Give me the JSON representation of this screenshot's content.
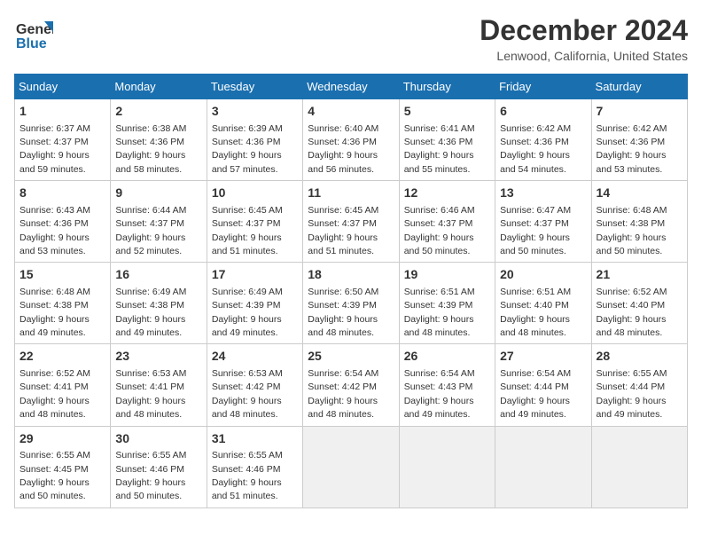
{
  "header": {
    "logo_line1": "General",
    "logo_line2": "Blue",
    "month": "December 2024",
    "location": "Lenwood, California, United States"
  },
  "weekdays": [
    "Sunday",
    "Monday",
    "Tuesday",
    "Wednesday",
    "Thursday",
    "Friday",
    "Saturday"
  ],
  "weeks": [
    [
      {
        "day": 1,
        "rise": "6:37 AM",
        "set": "4:37 PM",
        "hours": "9 hours and 59 minutes."
      },
      {
        "day": 2,
        "rise": "6:38 AM",
        "set": "4:36 PM",
        "hours": "9 hours and 58 minutes."
      },
      {
        "day": 3,
        "rise": "6:39 AM",
        "set": "4:36 PM",
        "hours": "9 hours and 57 minutes."
      },
      {
        "day": 4,
        "rise": "6:40 AM",
        "set": "4:36 PM",
        "hours": "9 hours and 56 minutes."
      },
      {
        "day": 5,
        "rise": "6:41 AM",
        "set": "4:36 PM",
        "hours": "9 hours and 55 minutes."
      },
      {
        "day": 6,
        "rise": "6:42 AM",
        "set": "4:36 PM",
        "hours": "9 hours and 54 minutes."
      },
      {
        "day": 7,
        "rise": "6:42 AM",
        "set": "4:36 PM",
        "hours": "9 hours and 53 minutes."
      }
    ],
    [
      {
        "day": 8,
        "rise": "6:43 AM",
        "set": "4:36 PM",
        "hours": "9 hours and 53 minutes."
      },
      {
        "day": 9,
        "rise": "6:44 AM",
        "set": "4:37 PM",
        "hours": "9 hours and 52 minutes."
      },
      {
        "day": 10,
        "rise": "6:45 AM",
        "set": "4:37 PM",
        "hours": "9 hours and 51 minutes."
      },
      {
        "day": 11,
        "rise": "6:45 AM",
        "set": "4:37 PM",
        "hours": "9 hours and 51 minutes."
      },
      {
        "day": 12,
        "rise": "6:46 AM",
        "set": "4:37 PM",
        "hours": "9 hours and 50 minutes."
      },
      {
        "day": 13,
        "rise": "6:47 AM",
        "set": "4:37 PM",
        "hours": "9 hours and 50 minutes."
      },
      {
        "day": 14,
        "rise": "6:48 AM",
        "set": "4:38 PM",
        "hours": "9 hours and 50 minutes."
      }
    ],
    [
      {
        "day": 15,
        "rise": "6:48 AM",
        "set": "4:38 PM",
        "hours": "9 hours and 49 minutes."
      },
      {
        "day": 16,
        "rise": "6:49 AM",
        "set": "4:38 PM",
        "hours": "9 hours and 49 minutes."
      },
      {
        "day": 17,
        "rise": "6:49 AM",
        "set": "4:39 PM",
        "hours": "9 hours and 49 minutes."
      },
      {
        "day": 18,
        "rise": "6:50 AM",
        "set": "4:39 PM",
        "hours": "9 hours and 48 minutes."
      },
      {
        "day": 19,
        "rise": "6:51 AM",
        "set": "4:39 PM",
        "hours": "9 hours and 48 minutes."
      },
      {
        "day": 20,
        "rise": "6:51 AM",
        "set": "4:40 PM",
        "hours": "9 hours and 48 minutes."
      },
      {
        "day": 21,
        "rise": "6:52 AM",
        "set": "4:40 PM",
        "hours": "9 hours and 48 minutes."
      }
    ],
    [
      {
        "day": 22,
        "rise": "6:52 AM",
        "set": "4:41 PM",
        "hours": "9 hours and 48 minutes."
      },
      {
        "day": 23,
        "rise": "6:53 AM",
        "set": "4:41 PM",
        "hours": "9 hours and 48 minutes."
      },
      {
        "day": 24,
        "rise": "6:53 AM",
        "set": "4:42 PM",
        "hours": "9 hours and 48 minutes."
      },
      {
        "day": 25,
        "rise": "6:54 AM",
        "set": "4:42 PM",
        "hours": "9 hours and 48 minutes."
      },
      {
        "day": 26,
        "rise": "6:54 AM",
        "set": "4:43 PM",
        "hours": "9 hours and 49 minutes."
      },
      {
        "day": 27,
        "rise": "6:54 AM",
        "set": "4:44 PM",
        "hours": "9 hours and 49 minutes."
      },
      {
        "day": 28,
        "rise": "6:55 AM",
        "set": "4:44 PM",
        "hours": "9 hours and 49 minutes."
      }
    ],
    [
      {
        "day": 29,
        "rise": "6:55 AM",
        "set": "4:45 PM",
        "hours": "9 hours and 50 minutes."
      },
      {
        "day": 30,
        "rise": "6:55 AM",
        "set": "4:46 PM",
        "hours": "9 hours and 50 minutes."
      },
      {
        "day": 31,
        "rise": "6:55 AM",
        "set": "4:46 PM",
        "hours": "9 hours and 51 minutes."
      },
      null,
      null,
      null,
      null
    ]
  ]
}
